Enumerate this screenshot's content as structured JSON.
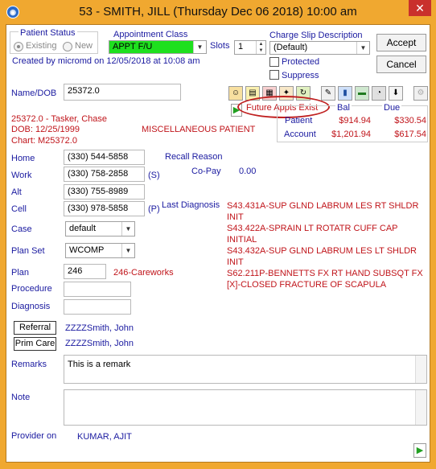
{
  "window": {
    "title": "53 - SMITH, JILL (Thursday Dec 06 2018) 10:00 am",
    "close": "✕"
  },
  "patient_status": {
    "label": "Patient Status",
    "existing": "Existing",
    "new": "New"
  },
  "created": "Created by micromd on 12/05/2018 at 10:08 am",
  "appointment_class": {
    "label": "Appointment Class",
    "value": "APPT F/U",
    "color": "#1ee01e"
  },
  "slots": {
    "label": "Slots",
    "value": "1"
  },
  "charge_slip": {
    "label": "Charge Slip Description",
    "value": "(Default)"
  },
  "protected_label": "Protected",
  "suppress_label": "Suppress",
  "accept_label": "Accept",
  "cancel_label": "Cancel",
  "name_dob": {
    "label": "Name/DOB",
    "value": "25372.0"
  },
  "future_appts": "Future Appts Exist",
  "balance": {
    "bal_header": "Bal",
    "due_header": "Due",
    "patient_label": "Patient",
    "account_label": "Account",
    "patient_bal": "$914.94",
    "patient_due": "$330.54",
    "account_bal": "$1,201.94",
    "account_due": "$617.54"
  },
  "patient_info": {
    "line1": "25372.0 - Tasker,  Chase",
    "dob": "DOB: 12/25/1999",
    "chart": "Chart: M25372.0",
    "misc": "MISCELLANEOUS PATIENT"
  },
  "phones": {
    "home_label": "Home",
    "home": "(330) 544-5858",
    "work_label": "Work",
    "work": "(330) 758-2858",
    "work_tag": "(S)",
    "alt_label": "Alt",
    "alt": "(330) 755-8989",
    "cell_label": "Cell",
    "cell": "(330) 978-5858",
    "cell_tag": "(P)"
  },
  "recall_reason_label": "Recall Reason",
  "copay": {
    "label": "Co-Pay",
    "value": "0.00"
  },
  "last_diagnosis": {
    "label": "Last Diagnosis",
    "items": [
      "S43.431A-SUP GLND LABRUM LES RT SHLDR INIT",
      "S43.422A-SPRAIN LT ROTATR CUFF CAP INITIAL",
      "S43.432A-SUP GLND LABRUM LES LT SHLDR INIT",
      "S62.211P-BENNETTS FX RT HAND SUBSQT FX",
      "[X]-CLOSED FRACTURE OF SCAPULA"
    ]
  },
  "case": {
    "label": "Case",
    "value": "default"
  },
  "plan_set": {
    "label": "Plan Set",
    "value": "WCOMP"
  },
  "plan": {
    "label": "Plan",
    "value": "246",
    "desc": "246-Careworks"
  },
  "procedure_label": "Procedure",
  "diagnosis_label": "Diagnosis",
  "referral": {
    "label": "Referral",
    "value": "ZZZZSmith, John"
  },
  "prim_care": {
    "label": "Prim Care",
    "value": "ZZZZSmith, John"
  },
  "remarks": {
    "label": "Remarks",
    "value": "This is a remark"
  },
  "note_label": "Note",
  "provider": {
    "label": "Provider on",
    "value": "KUMAR, AJIT"
  }
}
